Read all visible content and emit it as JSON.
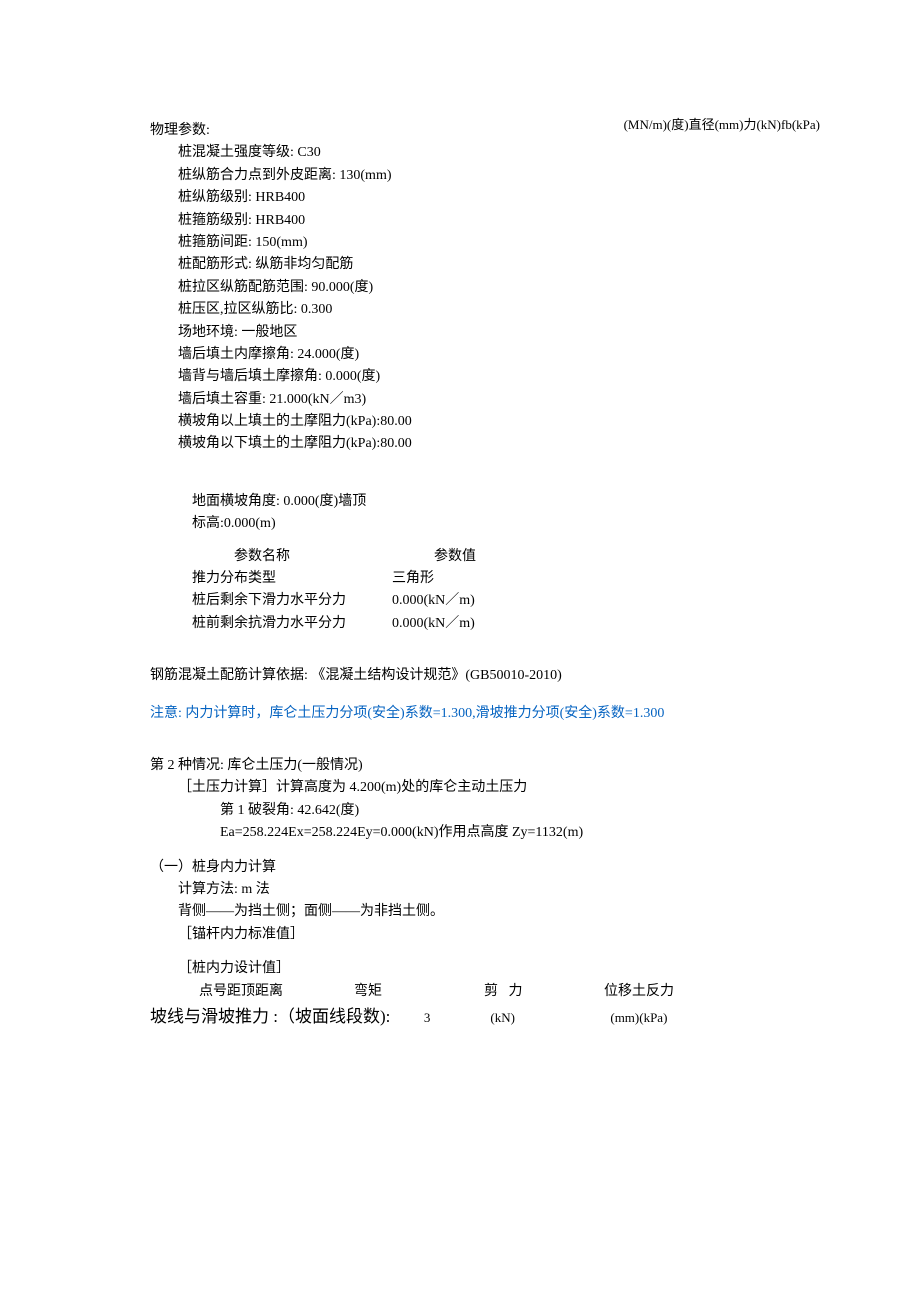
{
  "header": {
    "units_line": "(MN/m)(度)直径(mm)力(kN)fb(kPa)"
  },
  "physical_params": {
    "title": "物理参数:",
    "items": [
      "桩混凝土强度等级: C30",
      "桩纵筋合力点到外皮距离: 130(mm)",
      "桩纵筋级别: HRB400",
      "桩箍筋级别: HRB400",
      "桩箍筋间距: 150(mm)",
      "桩配筋形式: 纵筋非均匀配筋",
      "桩拉区纵筋配筋范围: 90.000(度)",
      "桩压区,拉区纵筋比: 0.300",
      "场地环境: 一般地区",
      "墙后填土内摩擦角: 24.000(度)",
      "墙背与墙后填土摩擦角: 0.000(度)",
      "墙后填土容重: 21.000(kN／m3)",
      "横坡角以上填土的土摩阻力(kPa):80.00",
      "横坡角以下填土的土摩阻力(kPa):80.00"
    ]
  },
  "sub_block": {
    "line1": "地面横坡角度: 0.000(度)墙顶",
    "line2": "标高:0.000(m)"
  },
  "param_table": {
    "header": {
      "c1": "参数名称",
      "c2": "参数值"
    },
    "rows": [
      {
        "c1": "推力分布类型",
        "c2": "三角形"
      },
      {
        "c1": "桩后剩余下滑力水平分力",
        "c2": "0.000(kN／m)"
      },
      {
        "c1": "桩前剩余抗滑力水平分力",
        "c2": "0.000(kN／m)"
      }
    ]
  },
  "design_basis": "钢筋混凝土配筋计算依据: 《混凝土结构设计规范》(GB50010-2010)",
  "note": "注意: 内力计算时，库仑土压力分项(安全)系数=1.300,滑坡推力分项(安全)系数=1.300",
  "case2": {
    "title": "第 2 种情况: 库仑土压力(一般情况)",
    "soil_calc_label": "［土压力计算］计算高度为 4.200(m)处的库仑主动土压力",
    "crack_angle": "第 1 破裂角: 42.642(度)",
    "ea_line": "Ea=258.224Ex=258.224Ey=0.000(kN)作用点高度 Zy=1132(m)"
  },
  "pile_calc": {
    "title": "（一）桩身内力计算",
    "method": "计算方法: m 法",
    "sides": "背侧——为挡土侧；面侧——为非挡土侧。",
    "anchor_label": "［锚杆内力标准值］",
    "design_label": "［桩内力设计值］"
  },
  "force_header": {
    "c1": "点号距顶距离",
    "c2": "弯矩",
    "c3a": "剪",
    "c3b": "力",
    "c4": "位移土反力"
  },
  "bottom": {
    "left_text": "坡线与滑坡推力 :（坡面线段数): ",
    "num": "3",
    "unit1": "(kN)",
    "unit2": "(mm)(kPa)"
  }
}
